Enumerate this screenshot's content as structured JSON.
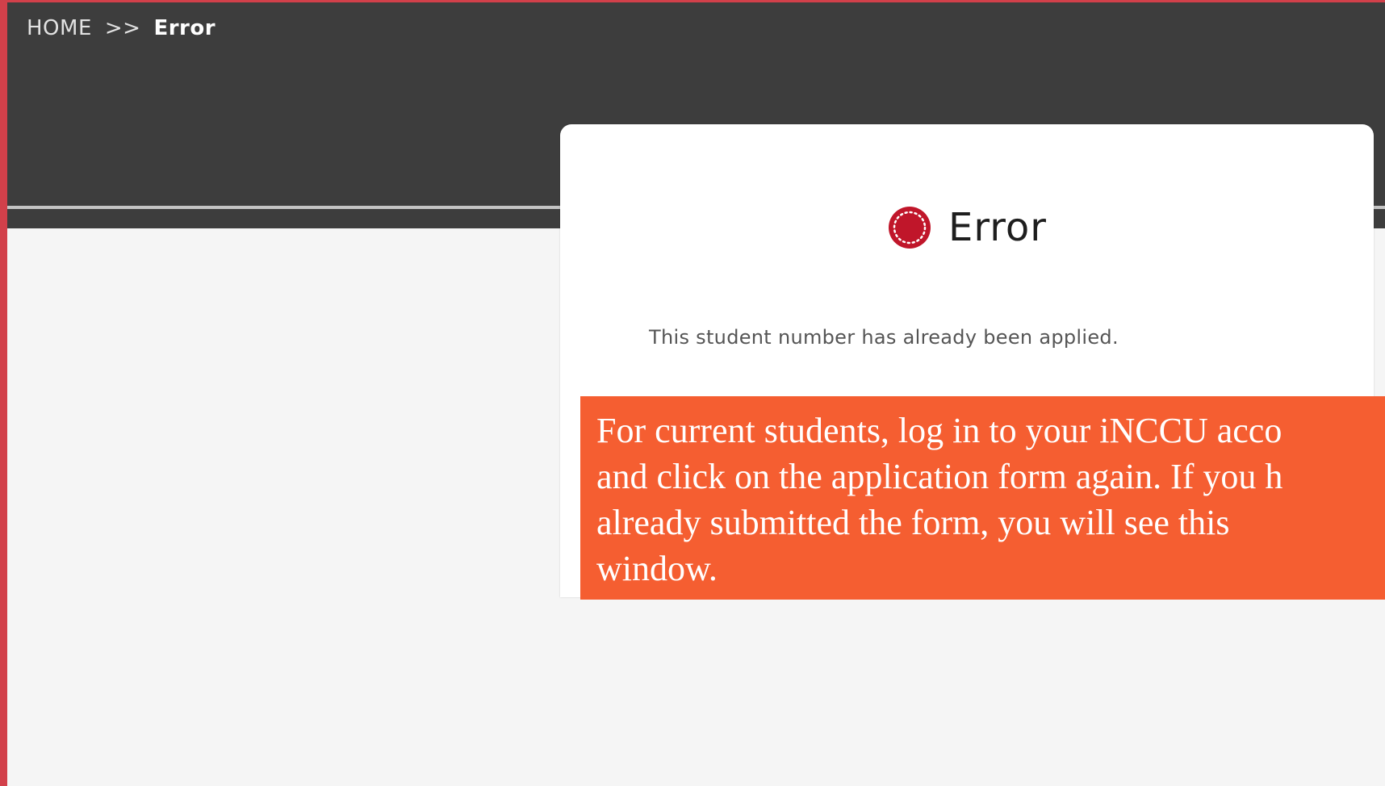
{
  "breadcrumb": {
    "home": "HOME",
    "separator": ">>",
    "current": "Error"
  },
  "dialog": {
    "icon": "error-circle-icon",
    "title": "Error",
    "message": "This student number has already been applied."
  },
  "callout": {
    "lines": [
      "For current students, log in to your iNCCU acco",
      "and click on the application form again. If you h",
      "already submitted the form, you will see this",
      "window."
    ]
  },
  "colors": {
    "accent": "#d2404a",
    "header_bg": "#3d3d3d",
    "callout_bg": "#f55e31",
    "icon": "#c0162a"
  }
}
